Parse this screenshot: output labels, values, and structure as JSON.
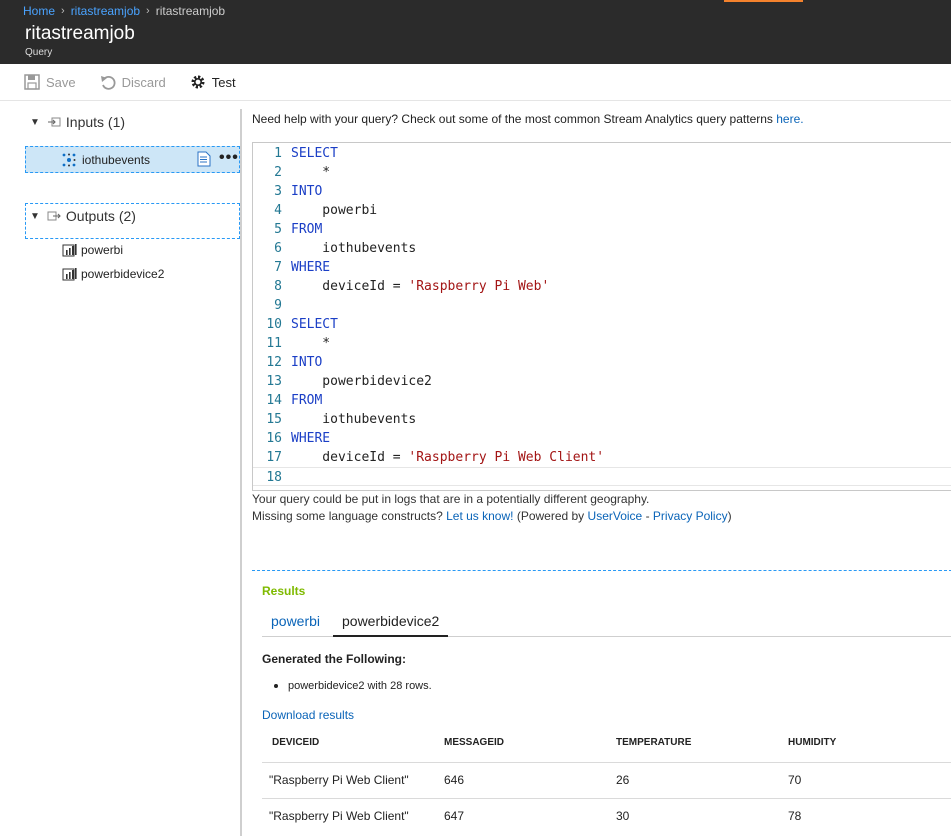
{
  "breadcrumb": {
    "home": "Home",
    "job": "ritastreamjob",
    "current": "ritastreamjob"
  },
  "blade": {
    "title": "ritastreamjob",
    "subtitle": "Query"
  },
  "toolbar": {
    "save": "Save",
    "discard": "Discard",
    "test": "Test"
  },
  "tree": {
    "inputs_label": "Inputs (1)",
    "input_item": "iothubevents",
    "outputs_label": "Outputs (2)",
    "output_items": [
      "powerbi",
      "powerbidevice2"
    ]
  },
  "help": {
    "text": "Need help with your query? Check out some of the most common Stream Analytics query patterns ",
    "link": "here."
  },
  "editor": {
    "lines": [
      {
        "n": "1",
        "kw": "SELECT",
        "text": "",
        "str": ""
      },
      {
        "n": "2",
        "kw": "",
        "text": "    *",
        "str": ""
      },
      {
        "n": "3",
        "kw": "INTO",
        "text": "",
        "str": ""
      },
      {
        "n": "4",
        "kw": "",
        "text": "    powerbi",
        "str": ""
      },
      {
        "n": "5",
        "kw": "FROM",
        "text": "",
        "str": ""
      },
      {
        "n": "6",
        "kw": "",
        "text": "    iothubevents",
        "str": ""
      },
      {
        "n": "7",
        "kw": "WHERE",
        "text": "",
        "str": ""
      },
      {
        "n": "8",
        "kw": "",
        "text": "    deviceId = ",
        "str": "'Raspberry Pi Web'"
      },
      {
        "n": "9",
        "kw": "",
        "text": "",
        "str": ""
      },
      {
        "n": "10",
        "kw": "SELECT",
        "text": "",
        "str": ""
      },
      {
        "n": "11",
        "kw": "",
        "text": "    *",
        "str": ""
      },
      {
        "n": "12",
        "kw": "INTO",
        "text": "",
        "str": ""
      },
      {
        "n": "13",
        "kw": "",
        "text": "    powerbidevice2",
        "str": ""
      },
      {
        "n": "14",
        "kw": "FROM",
        "text": "",
        "str": ""
      },
      {
        "n": "15",
        "kw": "",
        "text": "    iothubevents",
        "str": ""
      },
      {
        "n": "16",
        "kw": "WHERE",
        "text": "",
        "str": ""
      },
      {
        "n": "17",
        "kw": "",
        "text": "    deviceId = ",
        "str": "'Raspberry Pi Web Client'"
      },
      {
        "n": "18",
        "kw": "",
        "text": "",
        "str": ""
      }
    ]
  },
  "notes": {
    "geo": "Your query could be put in logs that are in a potentially different geography.",
    "missing": "Missing some language constructs? ",
    "let_us_know": "Let us know!",
    "powered": " (Powered by ",
    "uservoice": "UserVoice",
    "dash": " - ",
    "privacy": "Privacy Policy",
    "close": ")"
  },
  "results": {
    "title": "Results",
    "tabs": [
      "powerbi",
      "powerbidevice2"
    ],
    "active_tab": "powerbidevice2",
    "generated_title": "Generated the Following:",
    "generated_item": "powerbidevice2 with 28 rows.",
    "download": "Download results",
    "columns": [
      "DEVICEID",
      "MESSAGEID",
      "TEMPERATURE",
      "HUMIDITY"
    ],
    "rows": [
      [
        "\"Raspberry Pi Web Client\"",
        "646",
        "26",
        "70"
      ],
      [
        "\"Raspberry Pi Web Client\"",
        "647",
        "30",
        "78"
      ]
    ]
  },
  "colors": {
    "header_bg": "#2b2b2b",
    "accent_blue": "#2899f5",
    "link": "#0a64b8",
    "results_green": "#7fba00",
    "keyword": "#1b3fc6",
    "string": "#a31515",
    "orange": "#f4822d"
  }
}
